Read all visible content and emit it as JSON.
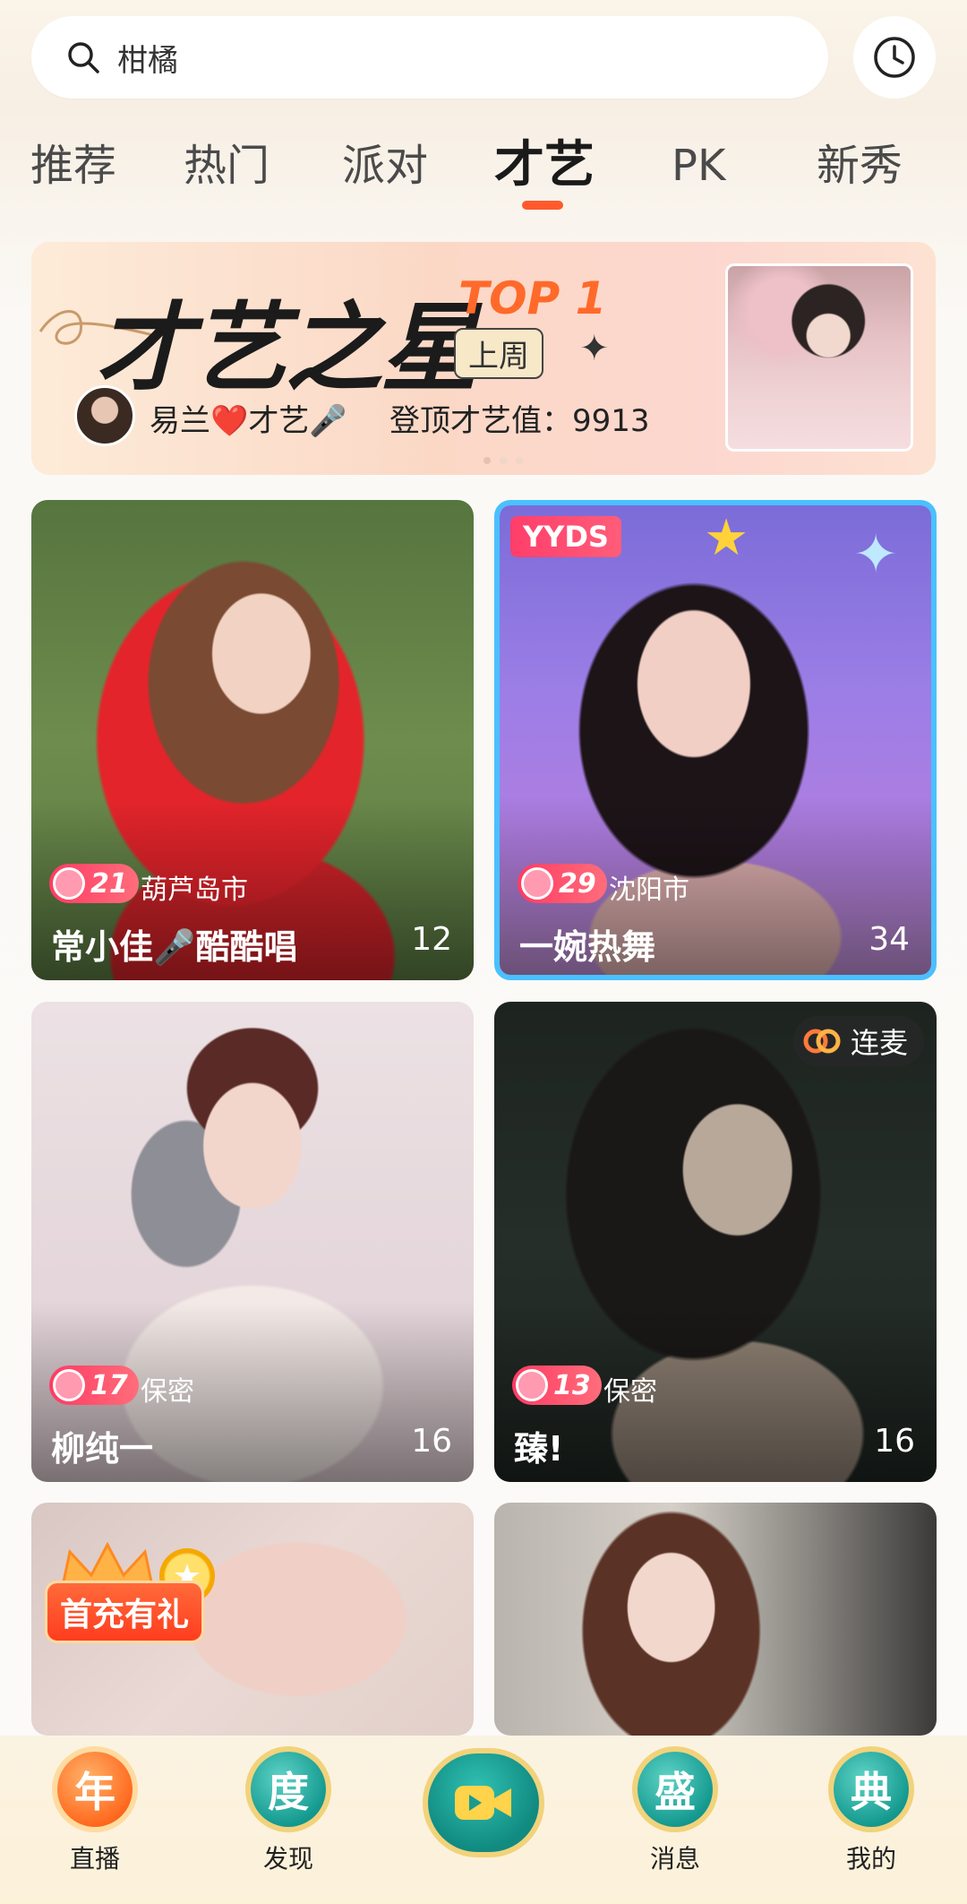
{
  "search": {
    "query": "柑橘"
  },
  "tabs": [
    {
      "label": "推荐"
    },
    {
      "label": "热门"
    },
    {
      "label": "派对"
    },
    {
      "label": "才艺",
      "active": true
    },
    {
      "label": "PK"
    },
    {
      "label": "新秀"
    }
  ],
  "banner": {
    "title": "才艺之星",
    "rank": "TOP 1",
    "period": "上周",
    "user": "易兰❤️才艺🎤",
    "score_text": "登顶才艺值：9913"
  },
  "streams": [
    {
      "level": "21",
      "city": "葫芦岛市",
      "name": "常小佳🎤酷酷唱",
      "viewers": "12"
    },
    {
      "tag": "YYDS",
      "level": "29",
      "city": "沈阳市",
      "name": "一婉热舞",
      "viewers": "34"
    },
    {
      "level": "17",
      "city": "保密",
      "name": "柳纯一",
      "viewers": "16"
    },
    {
      "badge": "连麦",
      "level": "13",
      "city": "保密",
      "name": "臻!",
      "viewers": "16"
    }
  ],
  "promo": {
    "label": "首充有礼"
  },
  "bottom_nav": [
    {
      "emblem": "年",
      "label": "直播"
    },
    {
      "emblem": "度",
      "label": "发现"
    },
    {
      "emblem": "盛",
      "label": "消息"
    },
    {
      "emblem": "典",
      "label": "我的"
    }
  ],
  "colors": {
    "accent": "#ff5a2c",
    "level_badge": "#ff3b63",
    "live_border": "#4ac0ff"
  }
}
